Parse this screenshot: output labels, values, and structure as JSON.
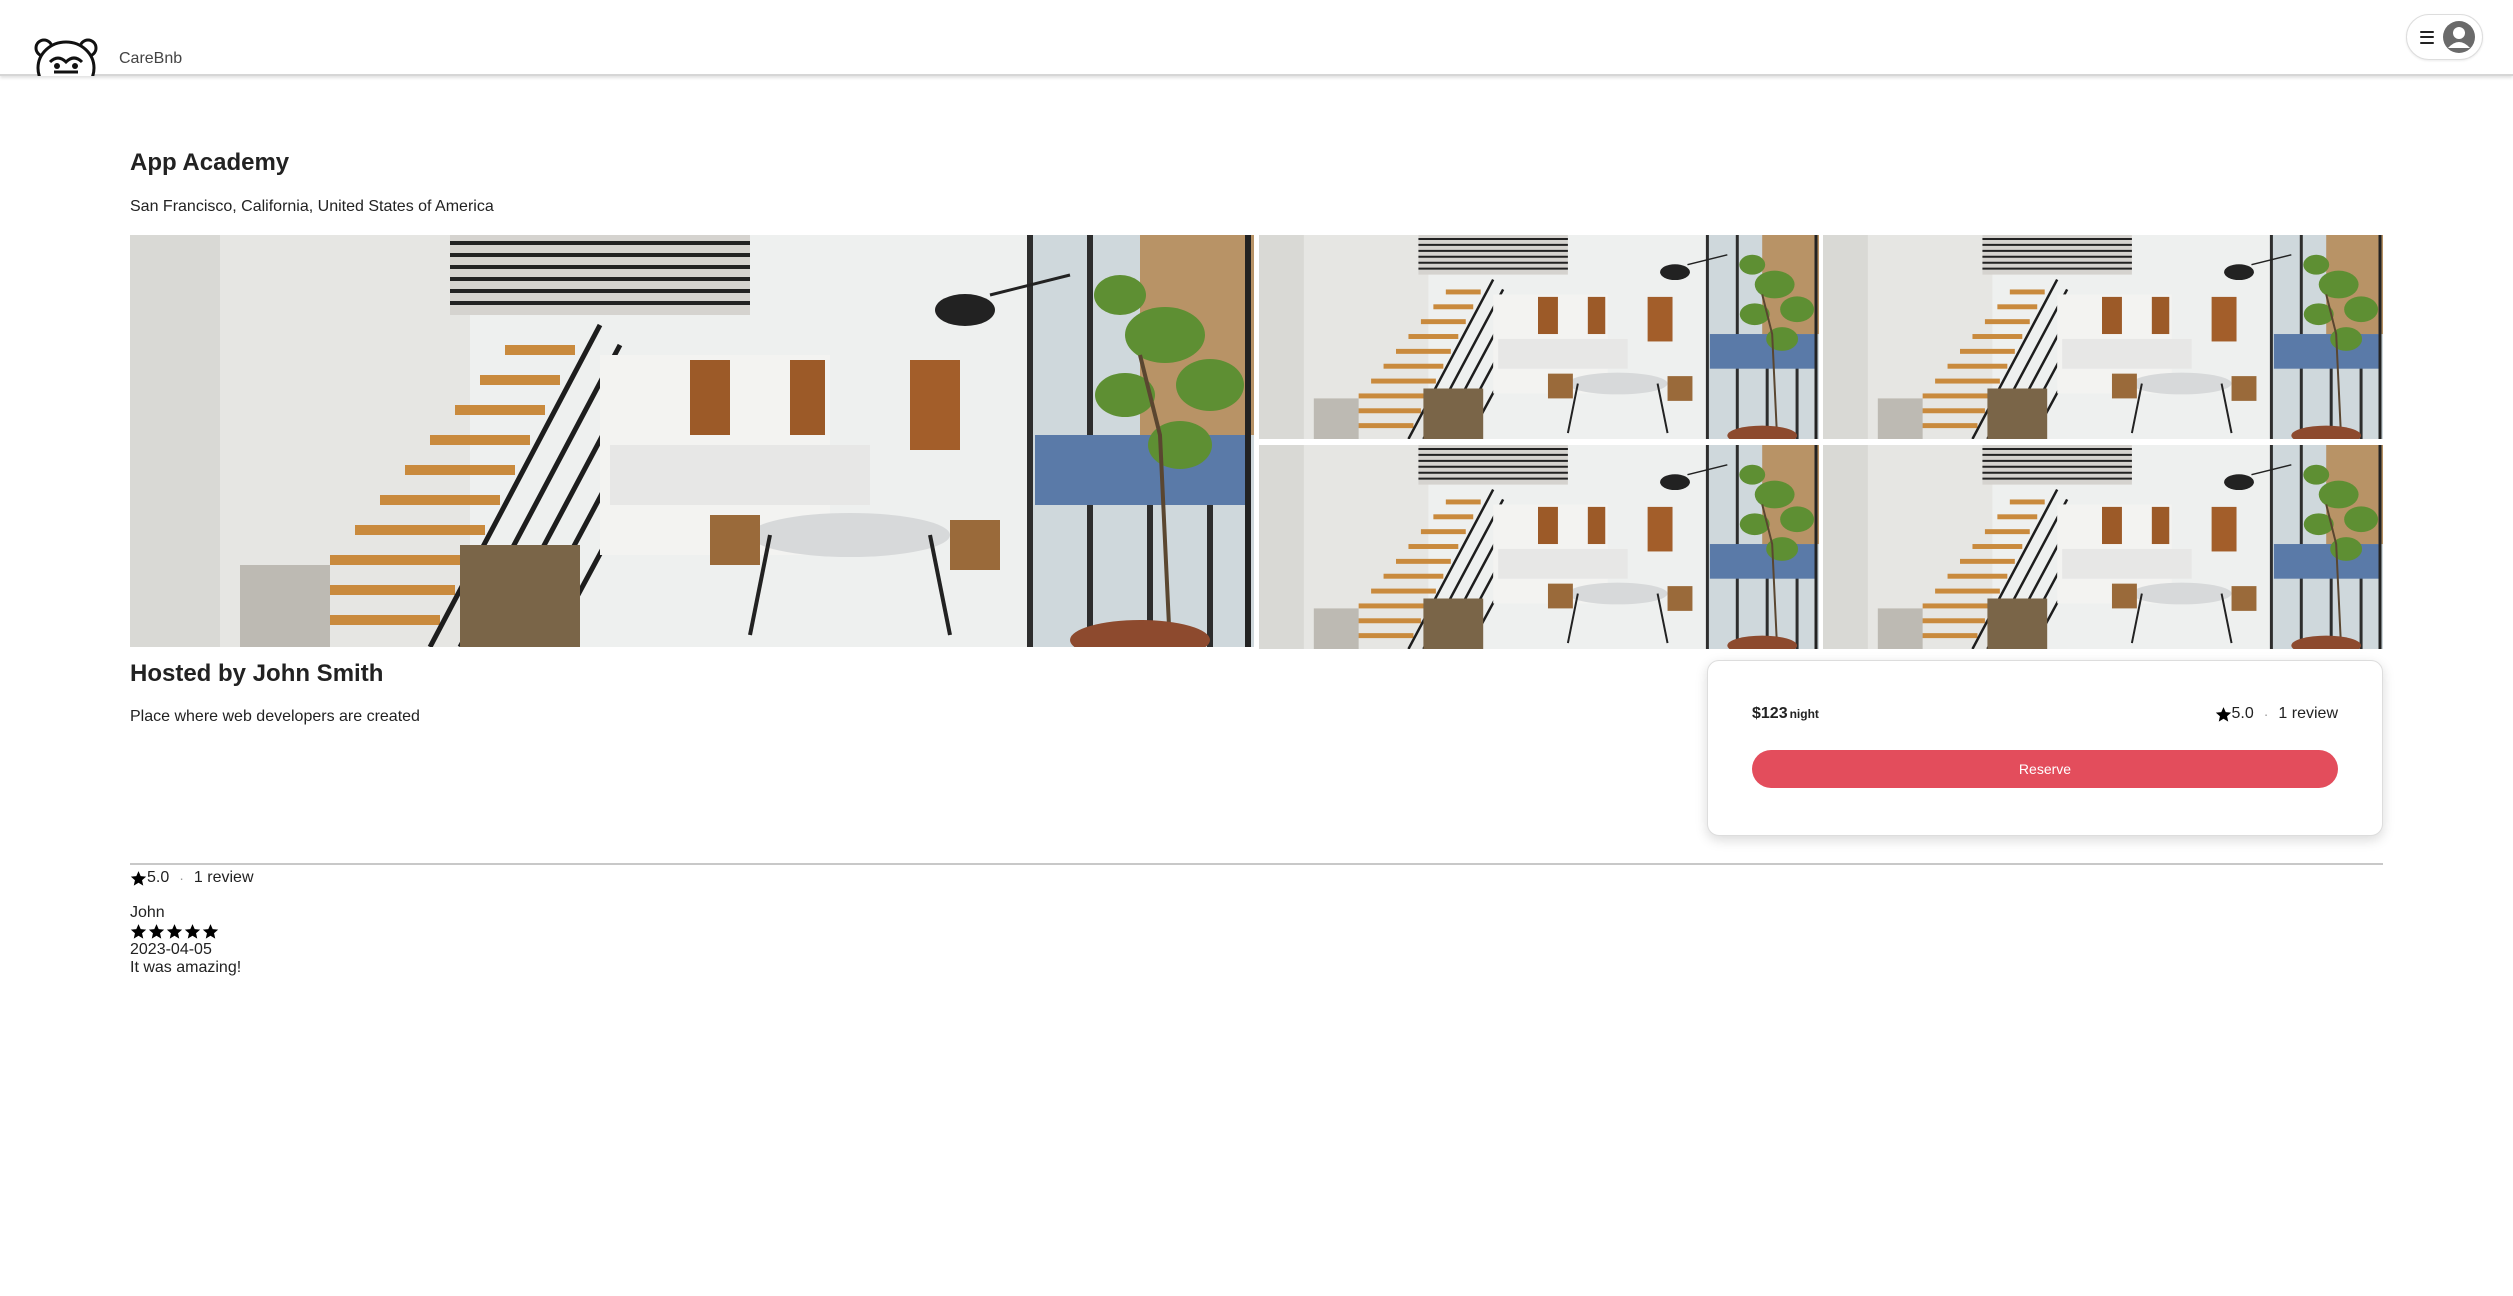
{
  "header": {
    "brand": "CareBnb",
    "menu": {
      "menu_icon": "hamburger-icon",
      "avatar_icon": "user-avatar-icon"
    }
  },
  "listing": {
    "title": "App Academy",
    "location": "San Francisco, California, United States of America",
    "photos": [
      "main-interior-photo",
      "interior-photo",
      "interior-photo",
      "interior-photo",
      "interior-photo"
    ],
    "host": "Hosted by John Smith",
    "description": "Place where web developers are created"
  },
  "booking": {
    "price": "$123",
    "unit": "night",
    "rating": "5.0",
    "separator": "·",
    "review_count": "1 review",
    "reserve_label": "Reserve",
    "accent_color": "#e34d5c"
  },
  "reviews": {
    "rating": "5.0",
    "separator": "·",
    "count": "1 review",
    "items": [
      {
        "author": "John",
        "stars": 5,
        "date": "2023-04-05",
        "text": "It was amazing!"
      }
    ]
  }
}
